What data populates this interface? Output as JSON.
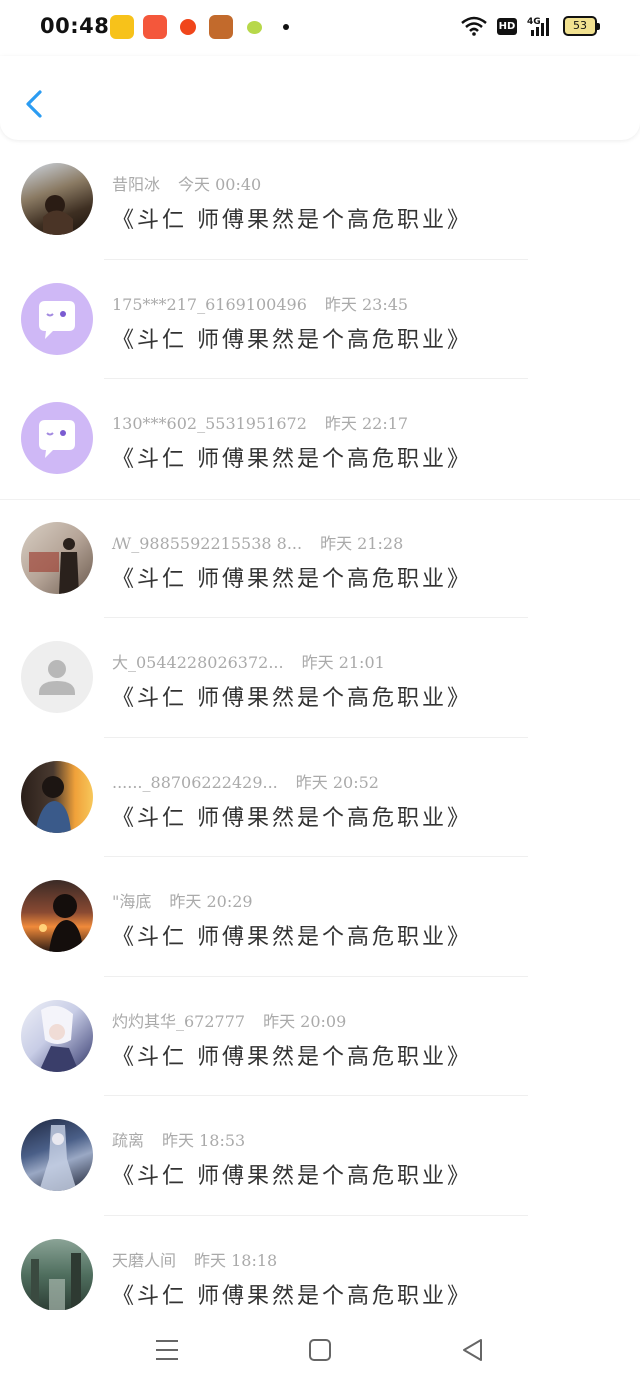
{
  "status": {
    "time": "00:48",
    "hd_label": "HD",
    "network_label": "4G",
    "battery": "53"
  },
  "items": [
    {
      "name": "昔阳冰",
      "date": "今天 00:40",
      "message": "《斗仁 师傅果然是个高危职业》",
      "avatar": "photo-road"
    },
    {
      "name": "175***217_6169100496",
      "date": "昨天 23:45",
      "message": "《斗仁 师傅果然是个高危职业》",
      "avatar": "default-chat"
    },
    {
      "name": "130***602_5531951672",
      "date": "昨天 22:17",
      "message": "《斗仁 师傅果然是个高危职业》",
      "avatar": "default-chat"
    },
    {
      "name": "ꟿ_9885592215538 8...",
      "date": "昨天 21:28",
      "message": "《斗仁 师傅果然是个高危职业》",
      "avatar": "photo-wall"
    },
    {
      "name": "大_0544228026372...",
      "date": "昨天 21:01",
      "message": "《斗仁 师傅果然是个高危职业》",
      "avatar": "default-person"
    },
    {
      "name": "......_88706222429...",
      "date": "昨天 20:52",
      "message": "《斗仁 师傅果然是个高危职业》",
      "avatar": "photo-sunset-boy"
    },
    {
      "name": "\"海底",
      "date": "昨天 20:29",
      "message": "《斗仁 师傅果然是个高危职业》",
      "avatar": "photo-silhouette"
    },
    {
      "name": "灼灼其华_672777",
      "date": "昨天 20:09",
      "message": "《斗仁 师傅果然是个高危职业》",
      "avatar": "photo-anime"
    },
    {
      "name": "疏离",
      "date": "昨天 18:53",
      "message": "《斗仁 师傅果然是个高危职业》",
      "avatar": "photo-dark-anime"
    },
    {
      "name": "天磨人间",
      "date": "昨天 18:18",
      "message": "《斗仁 师傅果然是个高危职业》",
      "avatar": "photo-green"
    }
  ],
  "colors": {
    "accent": "#2b9cf2",
    "chat_avatar_bg": "#cfb8f6"
  }
}
